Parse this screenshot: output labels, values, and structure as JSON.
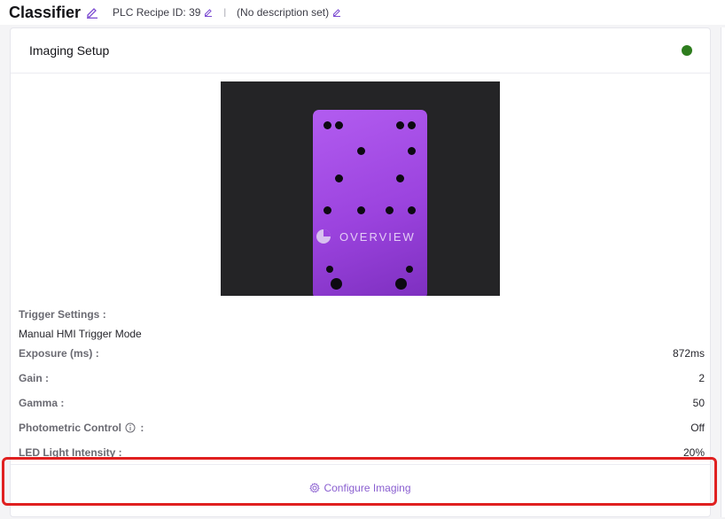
{
  "header": {
    "title": "Classifier",
    "recipe_id": "PLC Recipe ID: 39",
    "separator": "|",
    "description": "(No description set)"
  },
  "card": {
    "title": "Imaging Setup",
    "status_color": "#2e7d1e",
    "image": {
      "logo_text": "OVERVIEW",
      "plate_color": "#a34fe6"
    },
    "settings": {
      "trigger_label": "Trigger Settings",
      "trigger_value": "Manual HMI Trigger Mode",
      "exposure_label": "Exposure (ms)",
      "exposure_value": "872ms",
      "gain_label": "Gain",
      "gain_value": "2",
      "gamma_label": "Gamma",
      "gamma_value": "50",
      "photometric_label": "Photometric Control",
      "photometric_value": "Off",
      "led_label": "LED Light Intensity",
      "led_value": "20%"
    },
    "configure_label": "Configure Imaging"
  },
  "colors": {
    "accent": "#8a5fd0",
    "highlight": "#e02020"
  }
}
